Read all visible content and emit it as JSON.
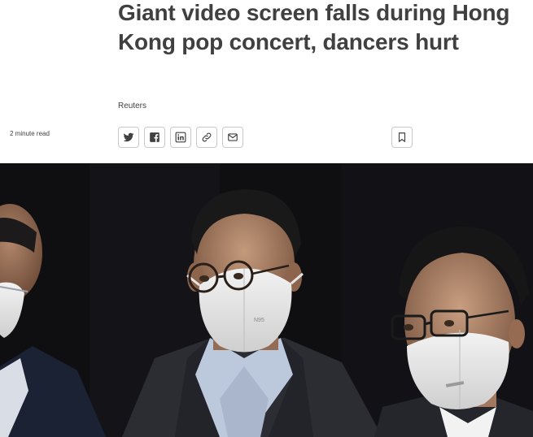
{
  "article": {
    "headline": "Giant video screen falls during Hong Kong pop concert, dancers hurt",
    "byline": "Reuters",
    "read_time": "2 minute read"
  },
  "share": {
    "icons": [
      "twitter-icon",
      "facebook-icon",
      "linkedin-icon",
      "link-icon",
      "email-icon"
    ],
    "bookmark_icon": "bookmark-icon"
  },
  "hero_image": {
    "mask_text": "N95"
  },
  "colors": {
    "text": "#404040",
    "border": "#c8c8c8",
    "photo_bg": "#101013"
  }
}
